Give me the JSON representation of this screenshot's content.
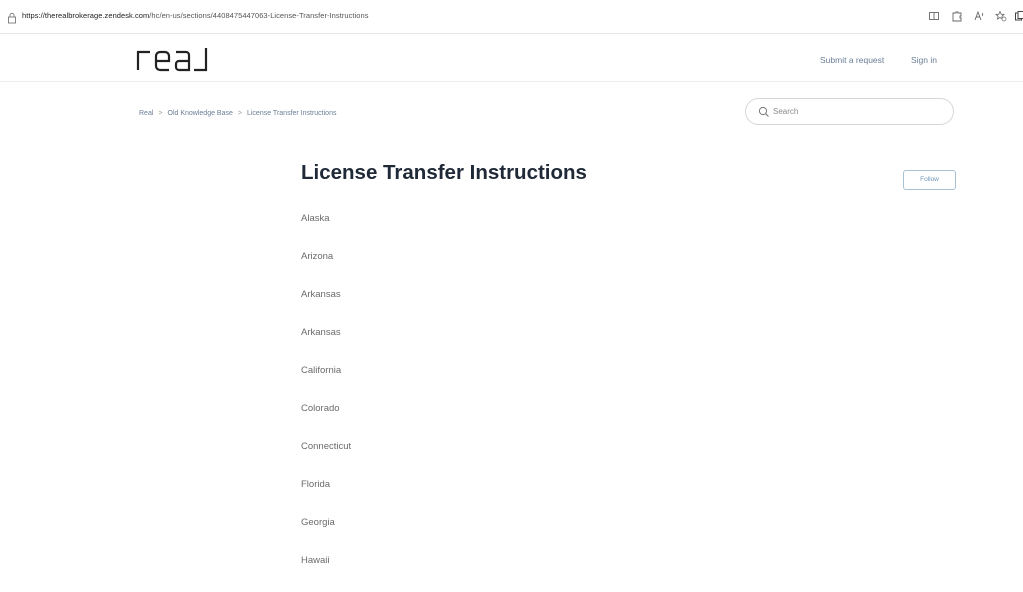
{
  "browser": {
    "url_host": "https://therealbrokerage.zendesk.com",
    "url_path": "/hc/en-us/sections/4408475447063-License-Transfer-Instructions",
    "toolbar_icons": [
      "reading-view-icon",
      "extensions-icon",
      "read-aloud-icon",
      "favorites-icon",
      "collections-icon"
    ]
  },
  "header": {
    "logo_text": "real",
    "submit_request_label": "Submit a request",
    "sign_in_label": "Sign in"
  },
  "breadcrumb": {
    "items": [
      "Real",
      "Old Knowledge Base",
      "License Transfer Instructions"
    ],
    "separator": ">"
  },
  "search": {
    "placeholder": "Search"
  },
  "section": {
    "title": "License Transfer Instructions",
    "follow_label": "Follow",
    "articles": [
      "Alaska",
      "Arizona",
      "Arkansas",
      "Arkansas",
      "California",
      "Colorado",
      "Connecticut",
      "Florida",
      "Georgia",
      "Hawaii"
    ]
  },
  "colors": {
    "link": "#6b7e96",
    "title": "#1f2937",
    "button_border": "#a8c2d8"
  }
}
